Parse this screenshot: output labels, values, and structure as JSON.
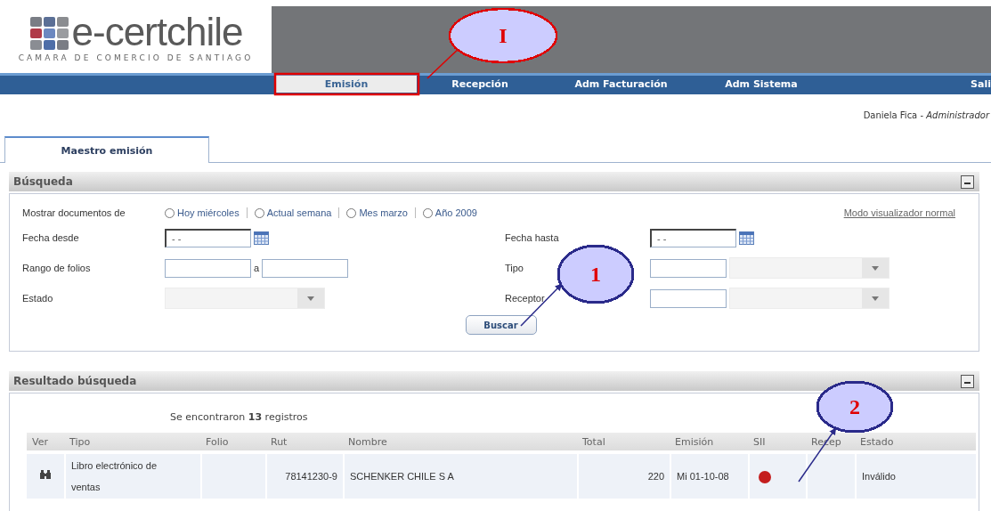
{
  "logo": {
    "name": "e-certchile",
    "subtitle": "CAMARA DE COMERCIO DE SANTIAGO"
  },
  "nav": [
    {
      "label": "Emisión",
      "selected": true
    },
    {
      "label": "Recepción",
      "selected": false
    },
    {
      "label": "Adm Facturación",
      "selected": false
    },
    {
      "label": "Adm Sistema",
      "selected": false
    },
    {
      "label": "Sali",
      "selected": false
    }
  ],
  "user": {
    "name": "Daniela Fica -",
    "role": "Administrador"
  },
  "tabs": [
    {
      "label": "Maestro emisión",
      "selected": true
    }
  ],
  "search": {
    "title": "Búsqueda",
    "show_label": "Mostrar documentos de",
    "periods": [
      {
        "label": "Hoy miércoles",
        "selected": false
      },
      {
        "label": "Actual semana",
        "selected": false
      },
      {
        "label": "Mes marzo",
        "selected": false
      },
      {
        "label": "Año 2009",
        "selected": false
      }
    ],
    "mode_link": "Modo visualizador normal",
    "fecha_desde": {
      "label": "Fecha desde",
      "value": "- -"
    },
    "fecha_hasta": {
      "label": "Fecha hasta",
      "value": "- -"
    },
    "rango": {
      "label": "Rango de folios",
      "between": "a"
    },
    "estado": {
      "label": "Estado"
    },
    "tipo": {
      "label": "Tipo"
    },
    "receptor": {
      "label": "Receptor"
    },
    "button": "Buscar"
  },
  "results": {
    "title": "Resultado búsqueda",
    "summary": "Se encontraron **13** registros",
    "columns": [
      "Ver",
      "Tipo",
      "Folio",
      "Rut",
      "Nombre",
      "Total",
      "Emisión",
      "SII",
      "Recep",
      "Estado"
    ],
    "rows": [
      {
        "tipo": "Libro electrónico de ventas",
        "rut": "78141230-9",
        "nombre": "SCHENKER CHILE S A",
        "total": "220",
        "emision": "Mi 01-10-08",
        "sii": {
          "color": "#c41e1e"
        },
        "estado": "Inválido"
      }
    ]
  },
  "annotations": [
    {
      "kind": "highlight",
      "color": "#e00000"
    },
    {
      "kind": "callout",
      "label": "I",
      "color": "#e00000"
    },
    {
      "kind": "callout",
      "label": "1",
      "color": "#2a2a8a"
    },
    {
      "kind": "callout",
      "label": "2",
      "color": "#2a2a8a"
    }
  ]
}
